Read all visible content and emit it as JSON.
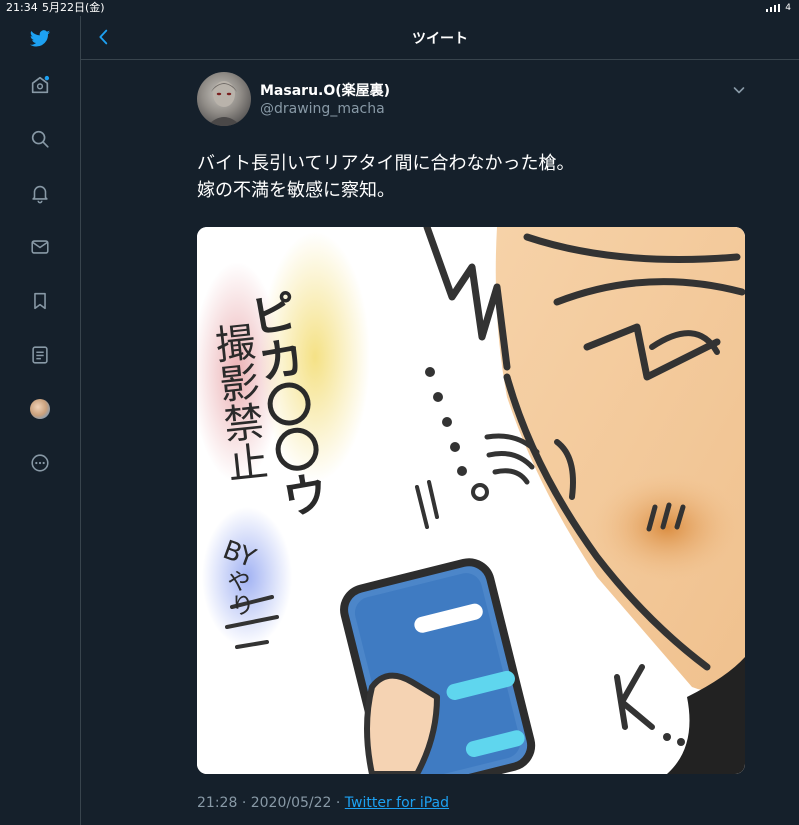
{
  "status_bar": {
    "time": "21:34",
    "date": "5月22日(金)",
    "battery_partial": "4"
  },
  "header": {
    "title": "ツイート"
  },
  "tweet": {
    "author_name": "Masaru.O(楽屋裏)",
    "author_handle": "@drawing_macha",
    "text_lines": [
      "バイト長引いてリアタイ間に合わなかった槍。",
      "嫁の不満を敏感に察知。"
    ],
    "time": "21:28",
    "separator": "·",
    "date": "2020/05/22",
    "source": "Twitter for iPad"
  },
  "illustration": {
    "text_pikaa": "ピカ〇〇ウ",
    "text_kinshi": "撮影禁止",
    "text_by": "BY",
    "text_yari": "やり"
  },
  "colors": {
    "background": "#15202b",
    "accent": "#1da1f2",
    "secondary_text": "#8899a6",
    "border": "#38444d"
  },
  "icons": {
    "sidebar": [
      "twitter-logo-icon",
      "home-icon",
      "search-icon",
      "bell-icon",
      "mail-icon",
      "bookmark-icon",
      "list-icon",
      "profile-avatar-icon",
      "more-icon"
    ],
    "header": [
      "back-arrow-icon"
    ],
    "tweet": [
      "chevron-down-icon"
    ]
  }
}
